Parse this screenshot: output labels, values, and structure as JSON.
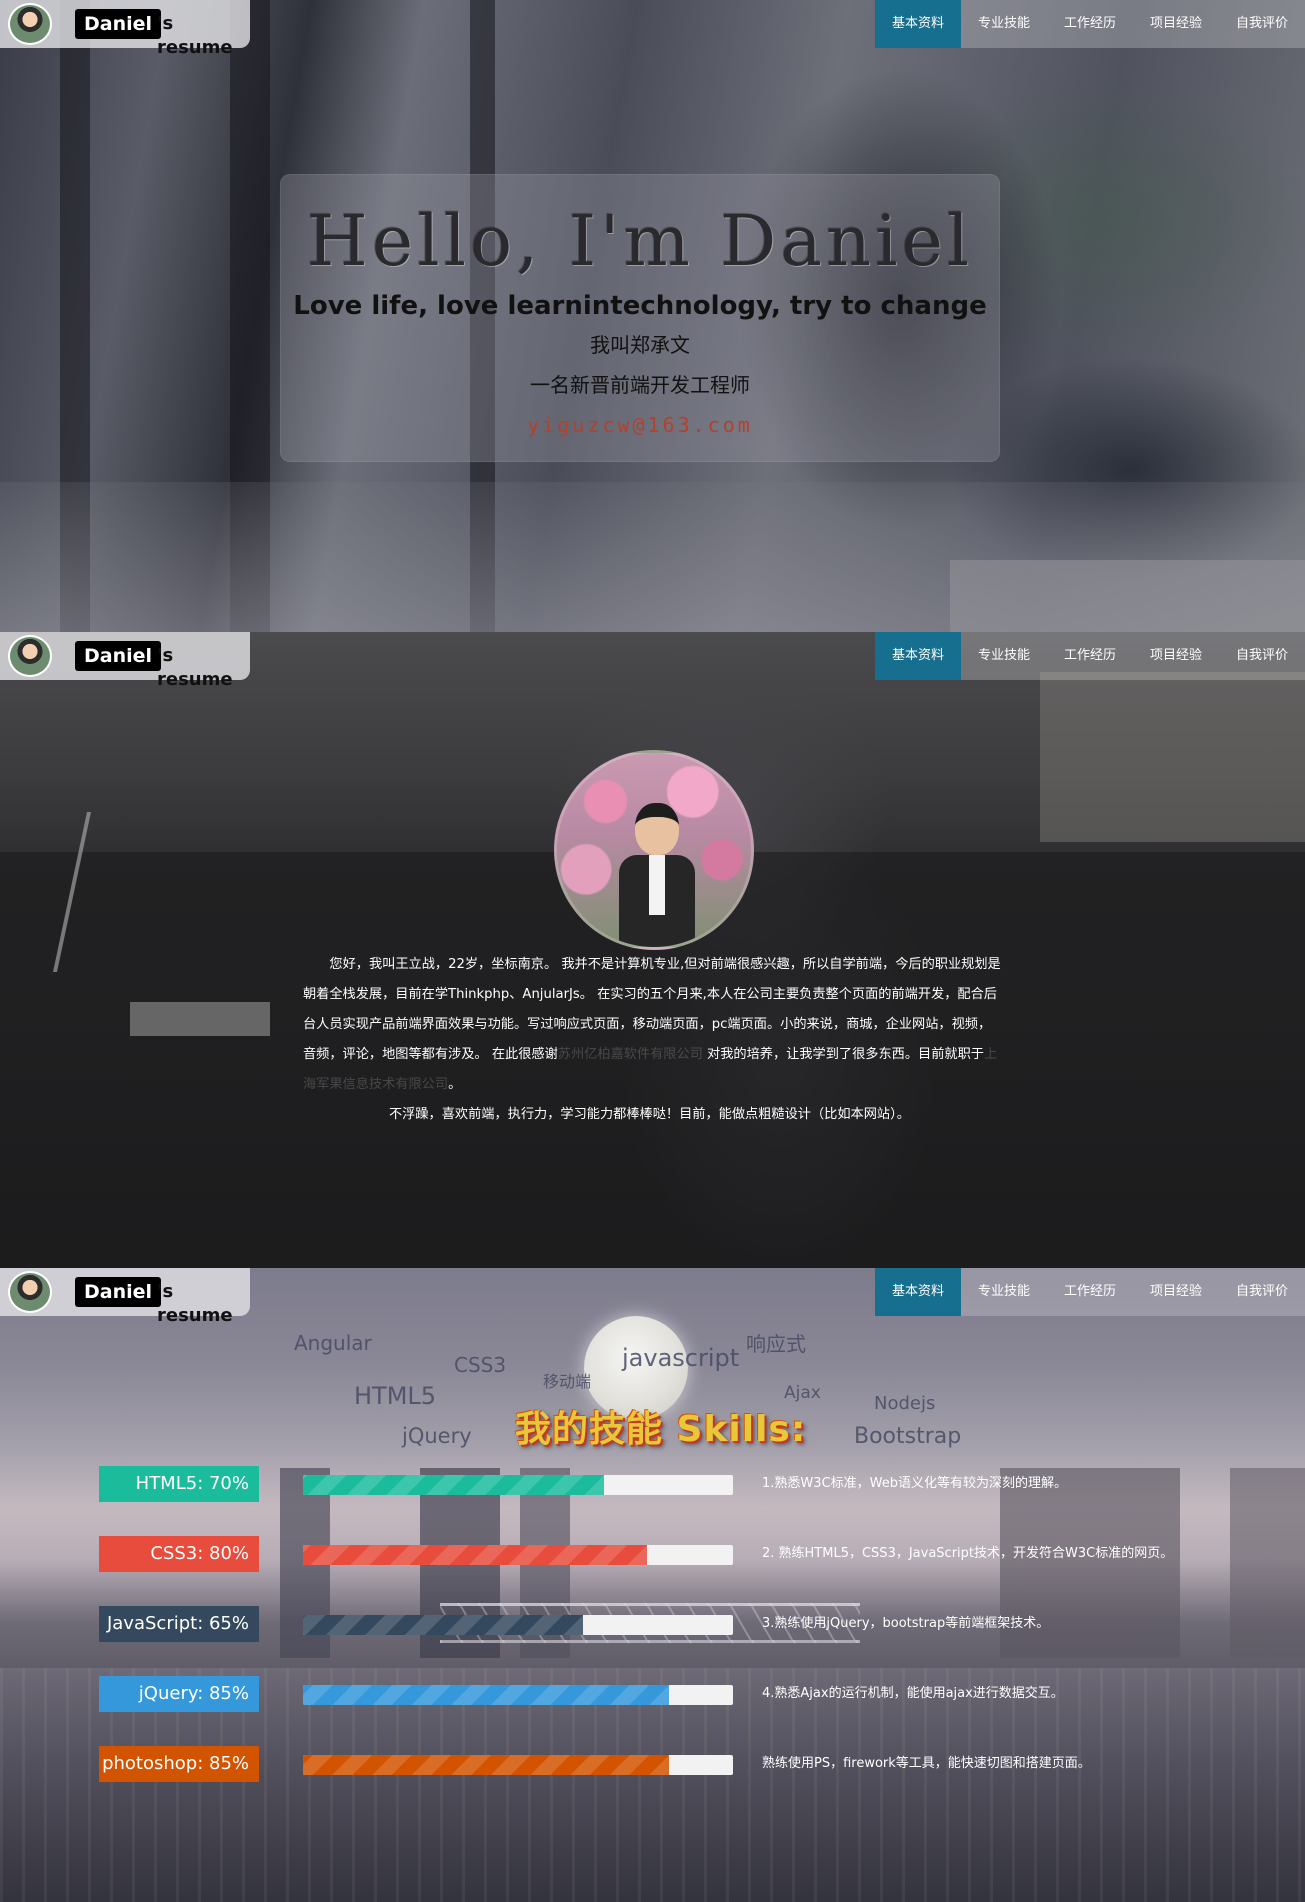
{
  "brand": {
    "name": "Daniel",
    "suffix": "'s resume"
  },
  "nav": {
    "items": [
      "基本资料",
      "专业技能",
      "工作经历",
      "项目经验",
      "自我评价"
    ],
    "active_index": 0,
    "active_color": "#166f8e"
  },
  "hero": {
    "title": "Hello, I'm Daniel",
    "tagline": "Love life, love learnintechnology, try to change",
    "name_line": "我叫郑承文",
    "role_line": "一名新晋前端开发工程师",
    "email": "yiguzcw@163.com"
  },
  "about": {
    "p1_a": "您好，我叫王立战，22岁，坐标南京。 我并不是计算机专业,但对前端很感兴趣，所以自学前端，今后的职业规划是朝着全栈发展，目前在学Thinkphp、AnjularJs。 在实习的五个月来,本人在公司主要负责整个页面的前端开发，配合后台人员实现产品前端界面效果与功能。写过响应式页面，移动端页面，pc端页面。小的来说，商城，企业网站，视频，音频，评论，地图等都有涉及。 在此很感谢",
    "p1_company1": "苏州亿柏嘉软件有限公司",
    "p1_b": " 对我的培养，让我学到了很多东西。目前就职于",
    "p1_company2": "上海军果信息技术有限公司",
    "p1_c": "。",
    "p2": "不浮躁，喜欢前端，执行力，学习能力都棒棒哒！目前，能做点粗糙设计（比如本网站）。"
  },
  "skills": {
    "title": "我的技能 Skills:",
    "cloud": [
      "Angular",
      "CSS3",
      "移动端",
      "javascript",
      "响应式",
      "HTML5",
      "Ajax",
      "Nodejs",
      "jQuery",
      "Bootstrap"
    ],
    "items": [
      {
        "label": "HTML5: 70%",
        "percent": 70,
        "color": "#1abc9c",
        "desc": "1.熟悉W3C标准，Web语义化等有较为深刻的理解。"
      },
      {
        "label": "CSS3: 80%",
        "percent": 80,
        "color": "#e74c3c",
        "desc": "2. 熟练HTML5，CSS3，JavaScript技术，开发符合W3C标准的网页。"
      },
      {
        "label": "JavaScript: 65%",
        "percent": 65,
        "color": "#34495e",
        "desc": "3.熟练使用jQuery，bootstrap等前端框架技术。"
      },
      {
        "label": "jQuery: 85%",
        "percent": 85,
        "color": "#3498db",
        "desc": "4.熟悉Ajax的运行机制，能使用ajax进行数据交互。"
      },
      {
        "label": "photoshop: 85%",
        "percent": 85,
        "color": "#d35400",
        "desc": "熟练使用PS，firework等工具，能快速切图和搭建页面。"
      }
    ]
  }
}
